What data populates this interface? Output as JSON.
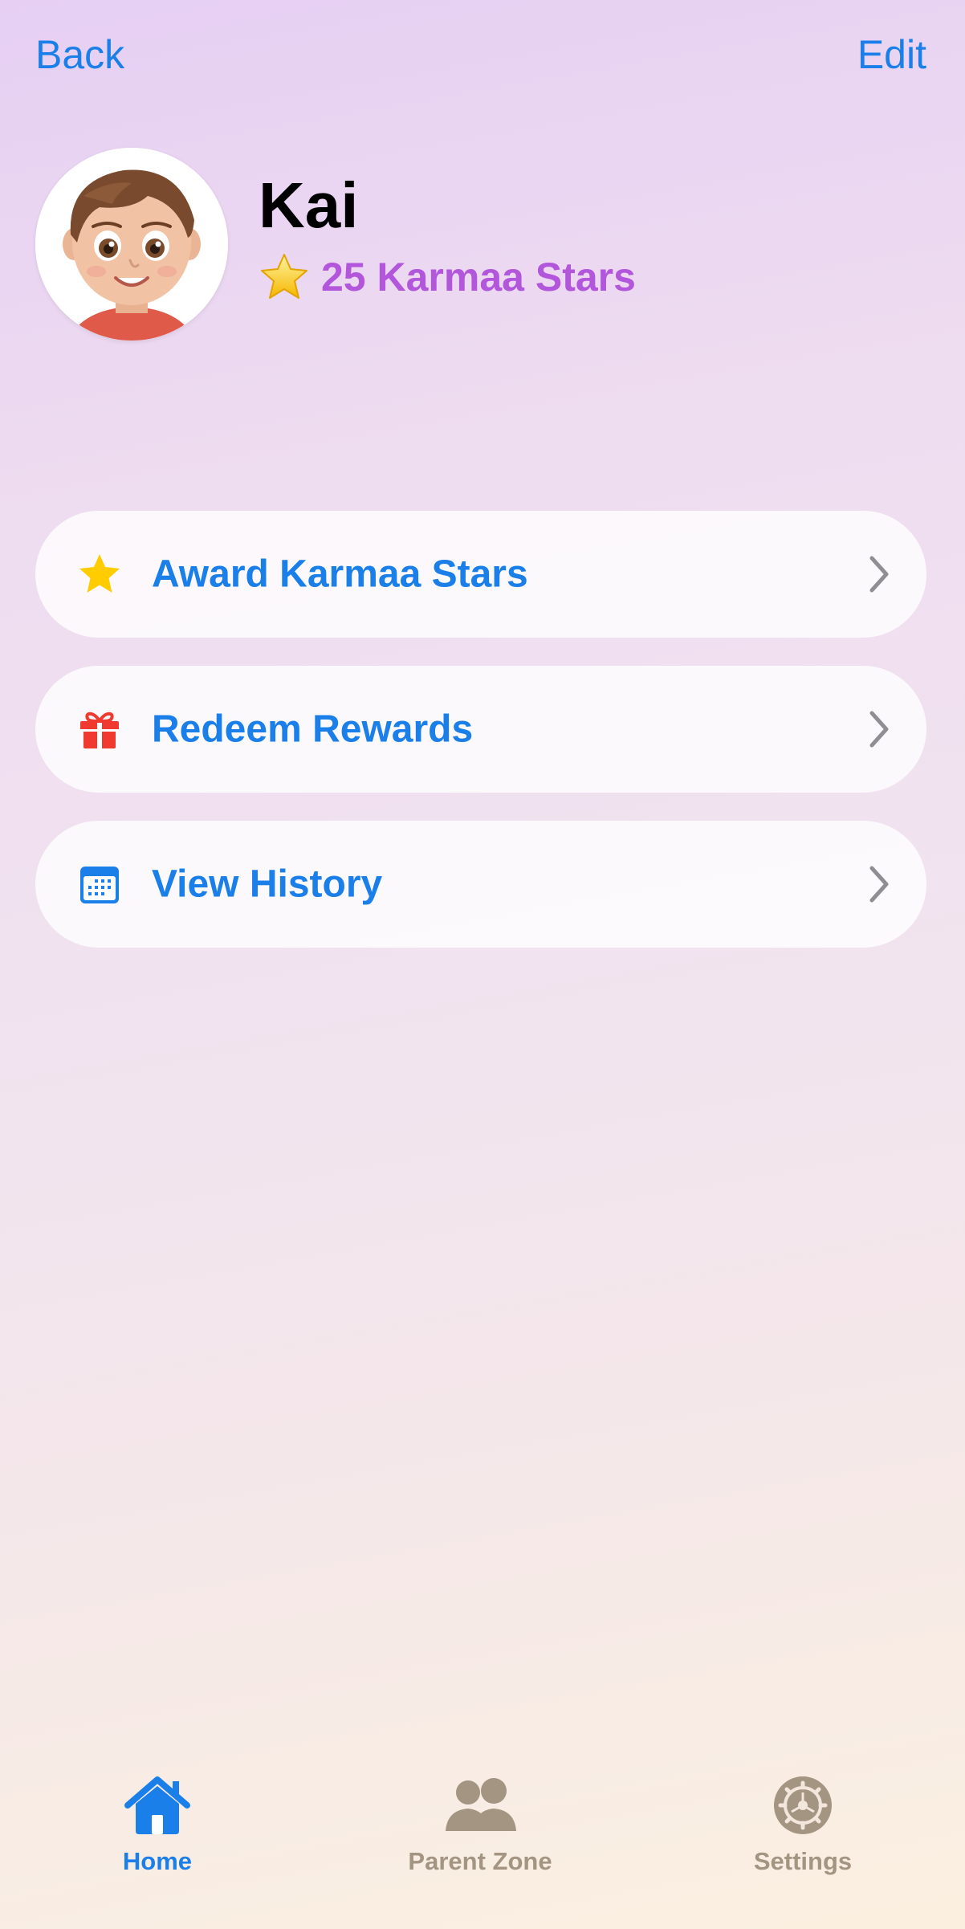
{
  "nav": {
    "back_label": "Back",
    "edit_label": "Edit"
  },
  "profile": {
    "name": "Kai",
    "stars_text": "25 Karmaa Stars",
    "avatar_icon": "child-avatar",
    "stars_icon": "star-icon"
  },
  "menu": {
    "items": [
      {
        "label": "Award Karmaa Stars",
        "icon": "star-icon",
        "icon_color": "#ffcc00"
      },
      {
        "label": "Redeem Rewards",
        "icon": "gift-icon",
        "icon_color": "#f0392f"
      },
      {
        "label": "View History",
        "icon": "calendar-icon",
        "icon_color": "#1a7fe8"
      }
    ]
  },
  "tabbar": {
    "tabs": [
      {
        "label": "Home",
        "icon": "house-icon",
        "active": true
      },
      {
        "label": "Parent Zone",
        "icon": "people-icon",
        "active": false
      },
      {
        "label": "Settings",
        "icon": "gear-icon",
        "active": false
      }
    ]
  },
  "colors": {
    "accent": "#1a7fe8",
    "stars_text": "#b256db",
    "inactive_tab": "#a39582",
    "chevron": "#8e8e93"
  }
}
